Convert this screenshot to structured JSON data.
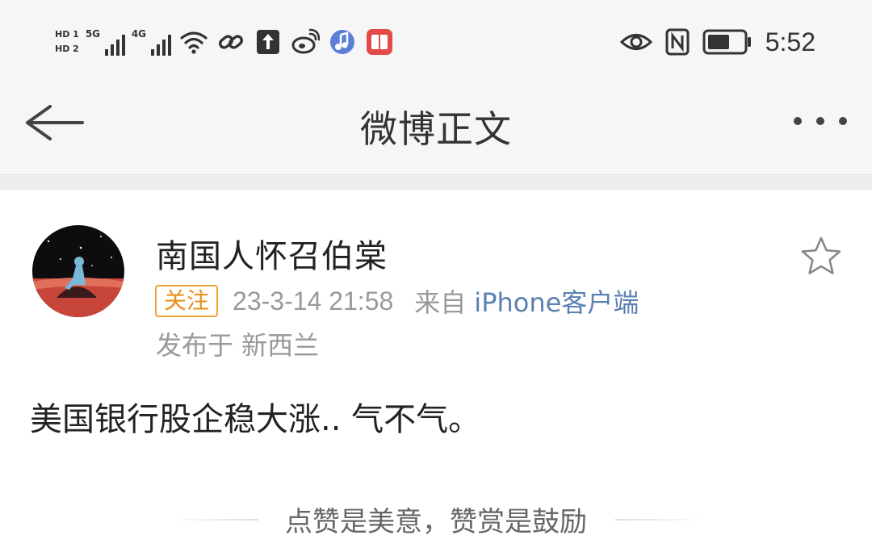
{
  "status_bar": {
    "hd1": "HD 1",
    "hd2": "HD 2",
    "signal1_tag": "5G",
    "signal2_tag": "4G",
    "time": "5:52",
    "left_icons": [
      "wifi-icon",
      "link-icon",
      "upload-icon",
      "weibo-icon",
      "music-icon",
      "book-icon"
    ],
    "right_icons": [
      "eye-icon",
      "nfc-icon",
      "battery-icon"
    ]
  },
  "nav": {
    "title": "微博正文",
    "back_icon": "back-arrow-icon",
    "more_icon": "more-icon"
  },
  "post": {
    "author": "南国人怀召伯棠",
    "follow_label": "关注",
    "timestamp": "23-3-14 21:58",
    "from_label": "来自",
    "client": "iPhone客户端",
    "location": "发布于 新西兰",
    "text": "美国银行股企稳大涨.. 气不气。",
    "reward_text": "点赞是美意，赞赏是鼓励"
  },
  "colors": {
    "follow_orange": "#e8901a",
    "client_link": "#5b80b2",
    "meta_gray": "#999999",
    "bar_background": "#f6f6f6"
  }
}
